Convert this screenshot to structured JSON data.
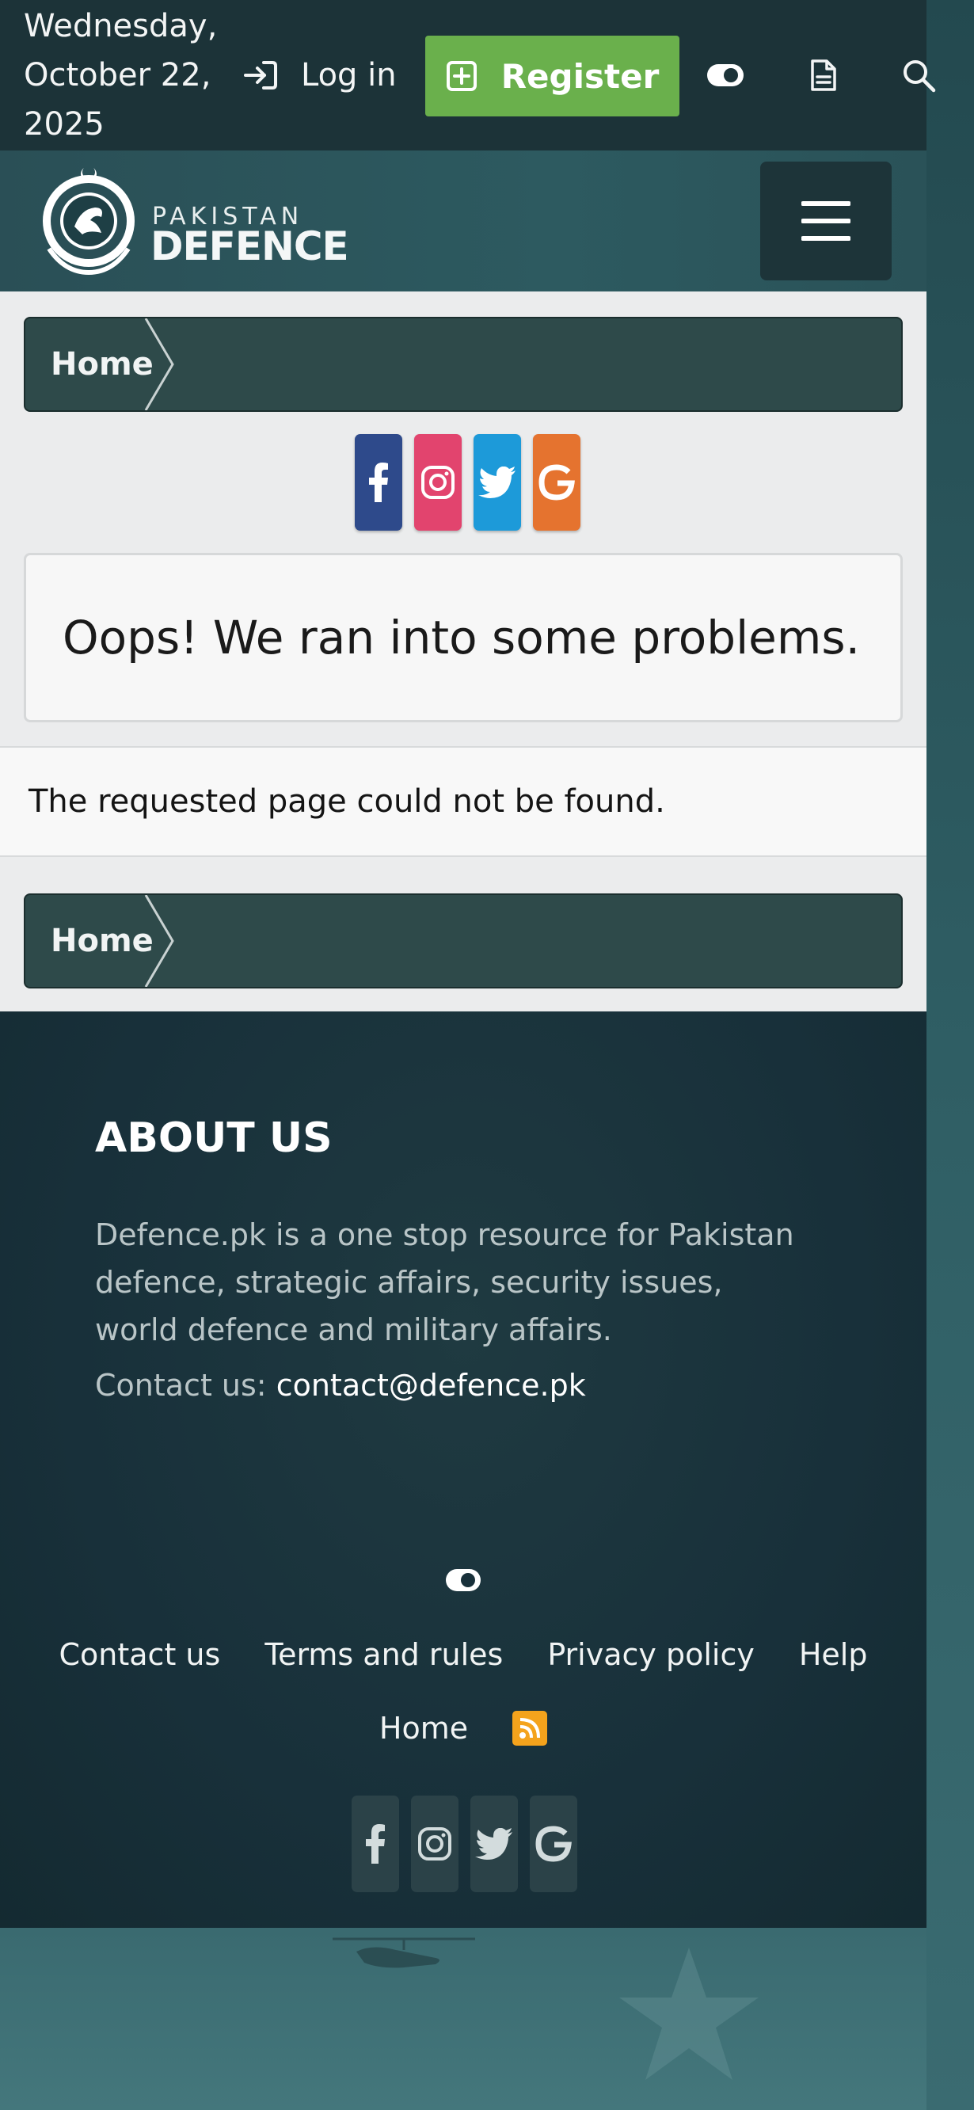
{
  "topbar": {
    "date": "Wednesday, October 22, 2025",
    "login_label": "Log in",
    "register_label": "Register",
    "icons": [
      "login-icon",
      "register-plus-icon",
      "theme-toggle-icon",
      "whats-new-icon",
      "search-icon"
    ]
  },
  "header": {
    "logo_top": "PAKISTAN",
    "logo_main": "DEFENCE",
    "logo_ring": "PAKISTAN DEFENCE",
    "menu_icon": "hamburger-icon"
  },
  "breadcrumb": {
    "home_label": "Home"
  },
  "social": [
    "facebook-icon",
    "instagram-icon",
    "twitter-icon",
    "google-icon"
  ],
  "error": {
    "title": "Oops! We ran into some problems.",
    "message": "The requested page could not be found."
  },
  "footer": {
    "about_title": "ABOUT US",
    "about_text": "Defence.pk is a one stop resource for Pakistan defence, strategic affairs, security issues, world defence and military affairs.",
    "contact_prefix": "Contact us:",
    "contact_email": "contact@defence.pk",
    "links": [
      "Contact us",
      "Terms and rules",
      "Privacy policy",
      "Help"
    ],
    "home_label": "Home"
  },
  "colors": {
    "topbar_bg": "#1c3338",
    "register_green": "#6ab04c",
    "breadcrumb_bg": "#2e4a4a",
    "facebook": "#2e4a8b",
    "instagram": "#e2446e",
    "twitter": "#1d9ad9",
    "google": "#e5732f",
    "rss": "#f4a31c",
    "footer_bg": "#18303a"
  }
}
